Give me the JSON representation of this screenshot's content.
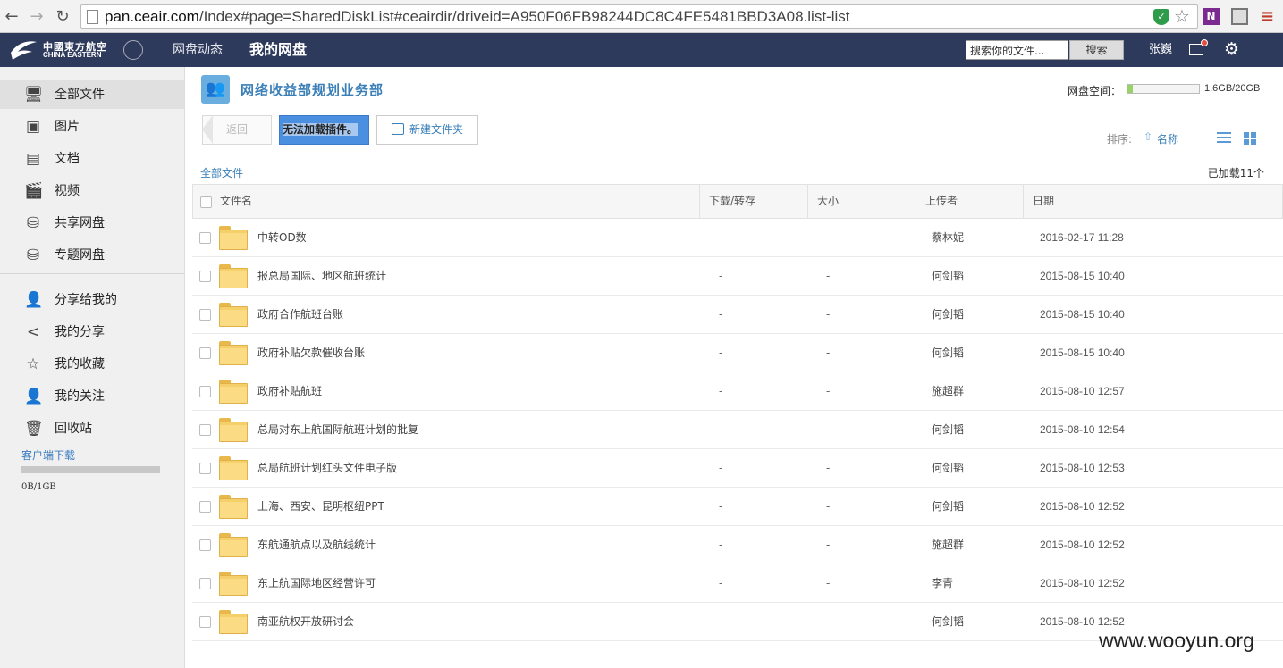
{
  "browser": {
    "url_host": "pan.ceair.com",
    "url_path": "/Index#page=SharedDiskList#ceairdir/driveid=A950F06FB98244DC8C4FE5481BBD3A08.list-list"
  },
  "header": {
    "logo_cn": "中國東方航空",
    "logo_en": "CHINA EASTERN",
    "nav": [
      "网盘动态",
      "我的网盘"
    ],
    "search_placeholder": "搜索你的文件...",
    "search_button": "搜索",
    "user": "张巍"
  },
  "sidebar": {
    "items": [
      {
        "label": "全部文件",
        "icon": "monitor-icon",
        "active": true
      },
      {
        "label": "图片",
        "icon": "picture-icon"
      },
      {
        "label": "文档",
        "icon": "document-icon"
      },
      {
        "label": "视频",
        "icon": "video-icon"
      },
      {
        "label": "共享网盘",
        "icon": "shared-drive-icon"
      },
      {
        "label": "专题网盘",
        "icon": "topic-drive-icon"
      },
      {
        "label": "分享给我的",
        "icon": "user-share-icon"
      },
      {
        "label": "我的分享",
        "icon": "share-icon"
      },
      {
        "label": "我的收藏",
        "icon": "star-icon"
      },
      {
        "label": "我的关注",
        "icon": "follow-icon"
      },
      {
        "label": "回收站",
        "icon": "trash-icon"
      }
    ],
    "client_download": "客户端下载",
    "quota_text": "0B/1GB",
    "quota_fraction": 0
  },
  "main": {
    "dept_title": "网络收益部规划业务部",
    "space_label": "网盘空间：",
    "space_value": "1.6GB/20GB",
    "space_fraction": 0.08,
    "back_button": "返回",
    "upload_text": "无法加载插件。",
    "new_folder_button": "新建文件夹",
    "sort_label": "排序:",
    "sort_field": "名称",
    "breadcrumb": "全部文件",
    "loaded_count": "已加载11个"
  },
  "table": {
    "headers": [
      "文件名",
      "下载/转存",
      "大小",
      "上传者",
      "日期"
    ],
    "rows": [
      {
        "name": "中转OD数",
        "dl": "-",
        "size": "-",
        "uploader": "蔡林妮",
        "date": "2016-02-17 11:28"
      },
      {
        "name": "报总局国际、地区航班统计",
        "dl": "-",
        "size": "-",
        "uploader": "何剑韬",
        "date": "2015-08-15 10:40"
      },
      {
        "name": "政府合作航班台账",
        "dl": "-",
        "size": "-",
        "uploader": "何剑韬",
        "date": "2015-08-15 10:40"
      },
      {
        "name": "政府补贴欠款催收台账",
        "dl": "-",
        "size": "-",
        "uploader": "何剑韬",
        "date": "2015-08-15 10:40"
      },
      {
        "name": "政府补贴航班",
        "dl": "-",
        "size": "-",
        "uploader": "施超群",
        "date": "2015-08-10 12:57"
      },
      {
        "name": "总局对东上航国际航班计划的批复",
        "dl": "-",
        "size": "-",
        "uploader": "何剑韬",
        "date": "2015-08-10 12:54"
      },
      {
        "name": "总局航班计划红头文件电子版",
        "dl": "-",
        "size": "-",
        "uploader": "何剑韬",
        "date": "2015-08-10 12:53"
      },
      {
        "name": "上海、西安、昆明枢纽PPT",
        "dl": "-",
        "size": "-",
        "uploader": "何剑韬",
        "date": "2015-08-10 12:52"
      },
      {
        "name": "东航通航点以及航线统计",
        "dl": "-",
        "size": "-",
        "uploader": "施超群",
        "date": "2015-08-10 12:52"
      },
      {
        "name": "东上航国际地区经营许可",
        "dl": "-",
        "size": "-",
        "uploader": "李青",
        "date": "2015-08-10 12:52"
      },
      {
        "name": "南亚航权开放研讨会",
        "dl": "-",
        "size": "-",
        "uploader": "何剑韬",
        "date": "2015-08-10 12:52"
      }
    ]
  },
  "watermark": "www.wooyun.org"
}
